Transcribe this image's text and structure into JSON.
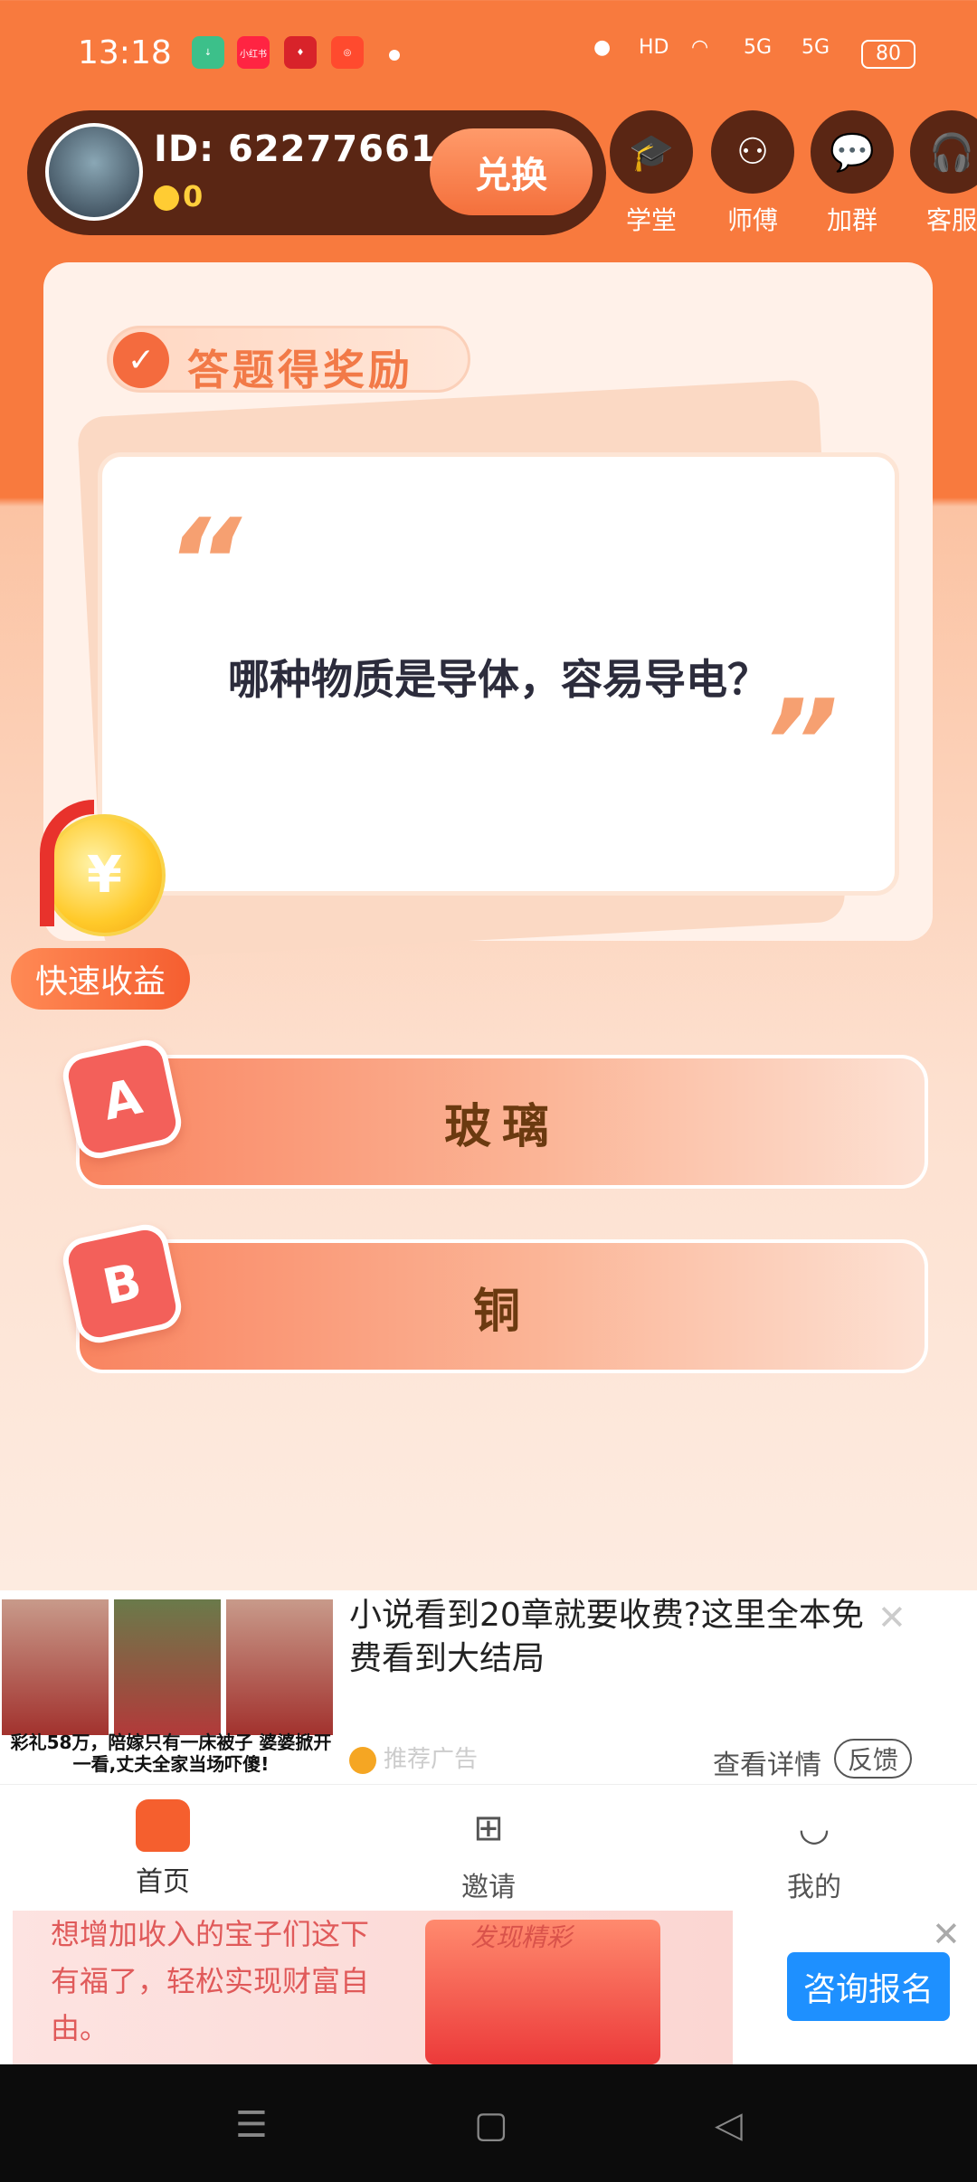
{
  "status_bar": {
    "time": "13:18",
    "apps": [
      "download",
      "小红书",
      "app3",
      "app4"
    ],
    "network": "HD",
    "signal1": "5G",
    "signal2": "5G",
    "battery": "80"
  },
  "header": {
    "user_id": "ID:  62277661",
    "coins": "0",
    "exchange_label": "兑换",
    "icons": [
      {
        "label": "学堂",
        "icon": "graduation-cap-icon"
      },
      {
        "label": "师傅",
        "icon": "user-add-icon"
      },
      {
        "label": "加群",
        "icon": "chat-bubble-icon"
      },
      {
        "label": "客服",
        "icon": "headset-icon"
      }
    ]
  },
  "quiz": {
    "tag_label": "答题得奖励",
    "question": "哪种物质是导体，容易导电？",
    "options": [
      {
        "letter": "A",
        "text": "玻璃"
      },
      {
        "letter": "B",
        "text": "铜"
      }
    ]
  },
  "quick_earn": {
    "label": "快速收益"
  },
  "ad_banner": {
    "caption": "彩礼58万，陪嫁只有一床被子 婆婆掀开一看,丈夫全家当场吓傻!",
    "title": "小说看到20章就要收费?这里全本免费看到大结局",
    "source": "推荐广告",
    "details": "查看详情",
    "feedback": "反馈"
  },
  "bottom_nav": {
    "items": [
      {
        "label": "首页",
        "icon": "home-icon"
      },
      {
        "label": "邀请",
        "icon": "plus-square-icon"
      },
      {
        "label": "我的",
        "icon": "smile-icon"
      }
    ]
  },
  "bottom_ad": {
    "text": "想增加收入的宝子们这下有福了，轻松实现财富自由。",
    "tag": "发现精彩",
    "button": "咨询报名"
  },
  "colors": {
    "brand_orange": "#f87a3e",
    "dark_brown": "#5a2614",
    "option_text": "#6b3a10",
    "badge_red": "#f3605a",
    "consult_blue": "#1e90ff"
  }
}
